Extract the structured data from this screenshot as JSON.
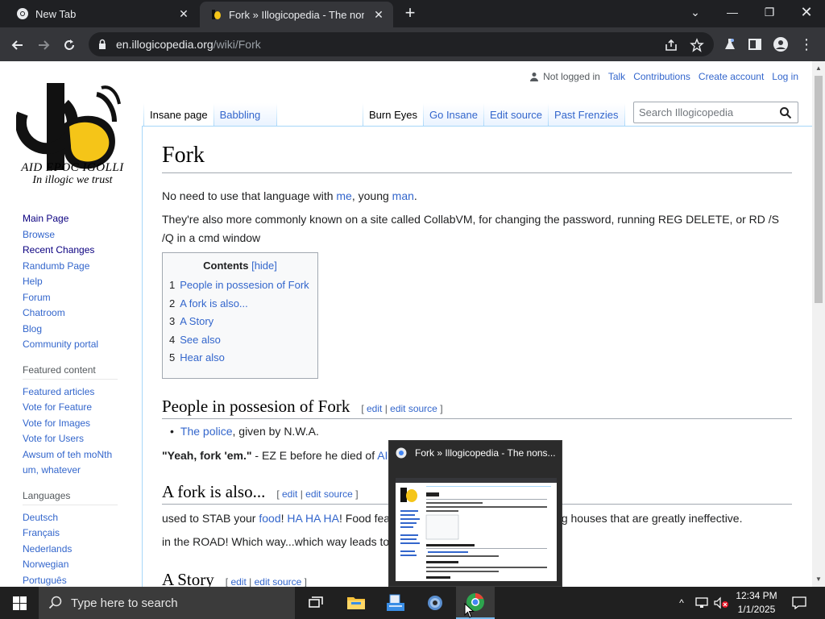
{
  "browser": {
    "tabs": [
      {
        "title": "New Tab"
      },
      {
        "title": "Fork » Illogicopedia - The nonse"
      }
    ],
    "new_tab_label": "+",
    "url_domain": "en.illogicopedia.org",
    "url_path": "/wiki/Fork"
  },
  "site": {
    "logo_text": "AID EPOC IGOLLI",
    "logo_tagline": "In illogic we trust",
    "nav": [
      "Main Page",
      "Browse",
      "Recent Changes",
      "Randumb Page",
      "Help",
      "Forum",
      "Chatroom",
      "Blog",
      "Community portal"
    ],
    "featured_heading": "Featured content",
    "featured": [
      "Featured articles",
      "Vote for Feature",
      "Vote for Images",
      "Vote for Users",
      "Awsum of teh moNth",
      "um, whatever"
    ],
    "languages_heading": "Languages",
    "languages": [
      "Deutsch",
      "Français",
      "Nederlands",
      "Norwegian",
      "Português"
    ]
  },
  "personal": {
    "not_logged_in": "Not logged in",
    "talk": "Talk",
    "contributions": "Contributions",
    "create_account": "Create account",
    "login": "Log in"
  },
  "page_tabs": {
    "left": [
      "Insane page",
      "Babbling"
    ],
    "right": [
      "Burn Eyes",
      "Go Insane",
      "Edit source",
      "Past Frenzies"
    ]
  },
  "search": {
    "placeholder": "Search Illogicopedia"
  },
  "article": {
    "title": "Fork",
    "p1_pre": "No need to use that language with ",
    "p1_link1": "me",
    "p1_mid": ", young ",
    "p1_link2": "man",
    "p1_post": ".",
    "p2": "They're also more commonly known on a site called CollabVM, for changing the password, running REG DELETE, or RD /S /Q in a cmd window",
    "toc_title": "Contents",
    "toc_hide": "[hide]",
    "toc": [
      {
        "num": "1",
        "label": "People in possesion of Fork"
      },
      {
        "num": "2",
        "label": "A fork is also..."
      },
      {
        "num": "3",
        "label": "A Story"
      },
      {
        "num": "4",
        "label": "See also"
      },
      {
        "num": "5",
        "label": "Hear also"
      }
    ],
    "s1_title": "People in possesion of Fork",
    "s1_bullet_link": "The police",
    "s1_bullet_text": ", given by N.W.A.",
    "s1_quote": "\"Yeah, fork 'em.\"",
    "s1_quote_after": " - EZ E before he died of ",
    "s1_quote_link": "AI",
    "s2_title": "A fork is also...",
    "s2_line1_pre": "used to STAB your ",
    "s2_line1_link1": "food",
    "s2_line1_mid": "! ",
    "s2_line1_link2": "HA HA HA",
    "s2_line1_post": "! Food fea",
    "s2_line1_tail": "og houses that are greatly ineffective.",
    "s2_line2": "in the ROAD! Which way...which way leads to",
    "s3_title": "A Story",
    "edit": "edit",
    "edit_source": "edit source"
  },
  "preview": {
    "title": "Fork » Illogicopedia - The nons..."
  },
  "taskbar": {
    "search_placeholder": "Type here to search",
    "time": "12:34 PM",
    "date": "1/1/2025"
  }
}
